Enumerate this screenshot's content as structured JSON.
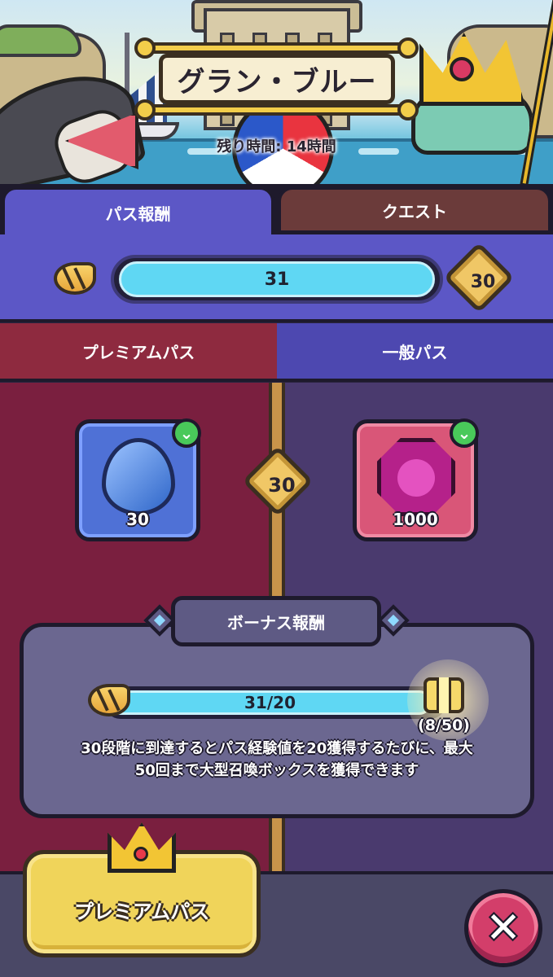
{
  "header": {
    "title": "グラン・ブルー",
    "remaining_time": "残り時間: 14時間"
  },
  "tabs": [
    {
      "label": "パス報酬",
      "active": true
    },
    {
      "label": "クエスト",
      "active": false
    }
  ],
  "pass_progress": {
    "current": "31",
    "level_badge": "30",
    "fill_fraction": 1.0
  },
  "pass_columns": {
    "premium_label": "プレミアムパス",
    "normal_label": "一般パス"
  },
  "rewards_row": {
    "level": "30",
    "premium_reward": {
      "icon": "blue-gem-drop-icon",
      "amount": "30",
      "claimed": true
    },
    "normal_reward": {
      "icon": "pink-gem-icon",
      "amount": "1000",
      "claimed": true
    }
  },
  "bonus": {
    "title": "ボーナス報酬",
    "progress_text": "31/20",
    "fill_fraction": 1.0,
    "count_text": "(8/50)",
    "description": "30段階に到達するとパス経験値を20獲得するたびに、最大50回まで大型召喚ボックスを獲得できます"
  },
  "bottom": {
    "premium_button_label": "プレミアムパス",
    "close_label": "✕"
  },
  "colors": {
    "tab_active": "#5c57c6",
    "tab_inactive": "#6b3b3a",
    "premium": "#8e2a3f",
    "normal": "#4d48b0",
    "progress_fill": "#5fd7f3",
    "button_gold": "#f0d45a",
    "close_pink": "#d33e6a"
  }
}
